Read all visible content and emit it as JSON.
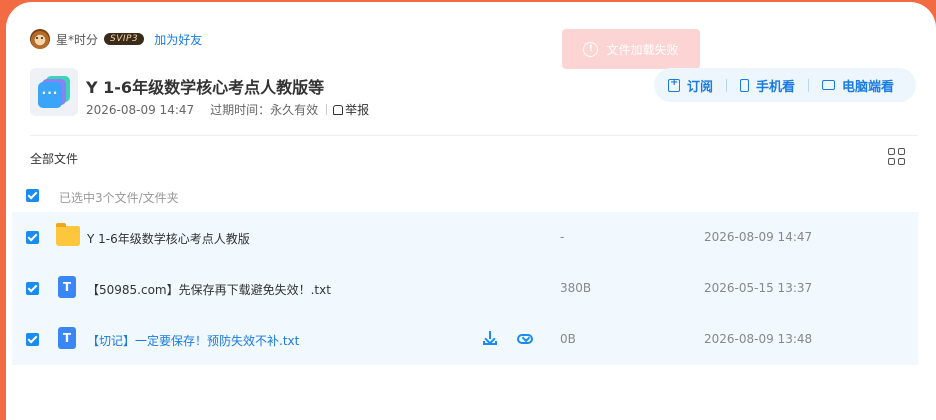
{
  "user": {
    "name": "星*时分",
    "vip_badge": "SVIP3",
    "add_friend": "加为好友"
  },
  "toast": {
    "message": "文件加载失败"
  },
  "share": {
    "title": "Y 1-6年级数学核心考点人教版等",
    "created": "2026-08-09 14:47",
    "expire_label": "过期时间：",
    "expire_value": "永久有效",
    "report": "举报"
  },
  "actions": {
    "subscribe": "订阅",
    "phone": "手机看",
    "pc": "电脑端看"
  },
  "breadcrumb": "全部文件",
  "selection_text": "已选中3个文件/文件夹",
  "files": [
    {
      "name": "Y 1-6年级数学核心考点人教版",
      "size": "-",
      "date": "2026-08-09 14:47",
      "type": "folder"
    },
    {
      "name": "【50985.com】先保存再下载避免失效！.txt",
      "size": "380B",
      "date": "2026-05-15 13:37",
      "type": "txt"
    },
    {
      "name": "【切记】一定要保存！预防失效不补.txt",
      "size": "0B",
      "date": "2026-08-09 13:48",
      "type": "txt"
    }
  ],
  "icons": {
    "txt_letter": "T",
    "toast_icon": "!",
    "share_icon_glyph": "···"
  },
  "colors": {
    "accent": "#1a7be0",
    "page_bg": "#f26b43",
    "row_bg": "#f1f8fe"
  }
}
